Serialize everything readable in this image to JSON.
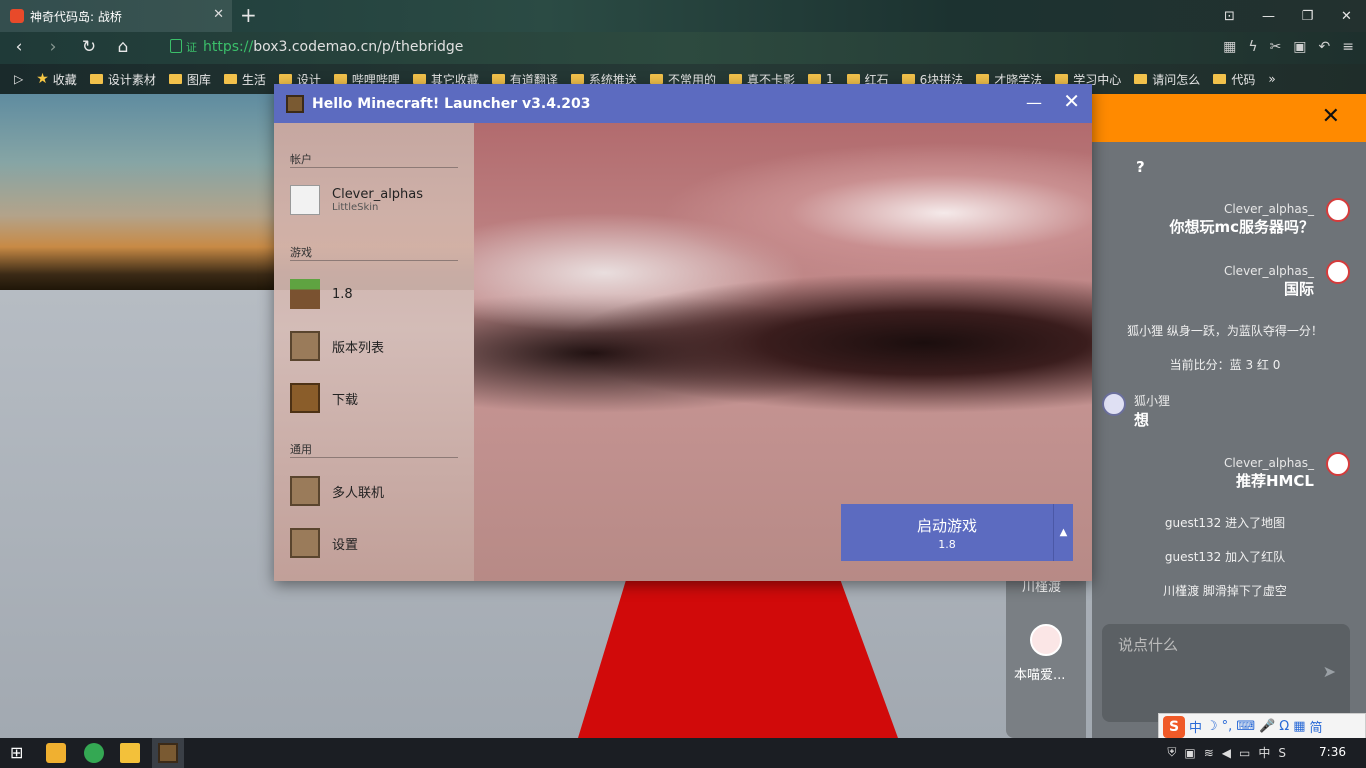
{
  "browser": {
    "tab_title": "神奇代码岛: 战桥",
    "tab_close": "✕",
    "new_tab": "+",
    "window_controls": [
      "⊡",
      "—",
      "❐",
      "✕"
    ],
    "url_cert": "证",
    "url_prefix": "https://",
    "url_rest": "box3.codemao.cn/p/thebridge",
    "bookmarks": [
      "收藏",
      "设计素材",
      "图库",
      "生活",
      "设计",
      "哔哩哔哩",
      "其它收藏",
      "有道翻译",
      "系统推送",
      "不常用的",
      "真不卡影",
      "1",
      "红石",
      "6块拼法",
      "才晓学法",
      "学习中心",
      "请问怎么",
      "代码"
    ],
    "bookmarks_more": "»"
  },
  "launcher": {
    "title": "Hello Minecraft! Launcher v3.4.203",
    "minimize": "—",
    "close": "✕",
    "section_account": "帐户",
    "account_name": "Clever_alphas",
    "account_source": "LittleSkin",
    "section_game": "游戏",
    "game_version": "1.8",
    "version_list": "版本列表",
    "download": "下载",
    "section_general": "通用",
    "multiplayer": "多人联机",
    "settings": "设置",
    "launch_label": "启动游戏",
    "launch_version": "1.8",
    "launch_arrow": "▲"
  },
  "game": {
    "player1_name": "川槿渡",
    "player2_name": "本喵爱...",
    "chat_close": "✕",
    "chat": {
      "m0_text": "?",
      "m1_user": "Clever_alphas_",
      "m1_text": "你想玩mc服务器吗？",
      "m2_user": "Clever_alphas_",
      "m2_text": "国际",
      "s1": "狐小狸 纵身一跃，为蓝队夺得一分！",
      "s2": "当前比分：蓝 3 红 0",
      "m3_user": "狐小狸",
      "m3_text": "想",
      "m4_user": "Clever_alphas_",
      "m4_text": "推荐HMCL",
      "s3": "guest132 进入了地图",
      "s4": "guest132 加入了红队",
      "s5": "川槿渡 脚滑掉下了虚空",
      "input_placeholder": "说点什么",
      "send_icon": "➤"
    }
  },
  "taskbar": {
    "clock": "7:36",
    "ime_s": "S",
    "ime_items": [
      "中",
      "☽",
      "°,",
      "⌨",
      "🎤",
      "Ω",
      "▦",
      "简"
    ],
    "tray_lang": "中"
  }
}
